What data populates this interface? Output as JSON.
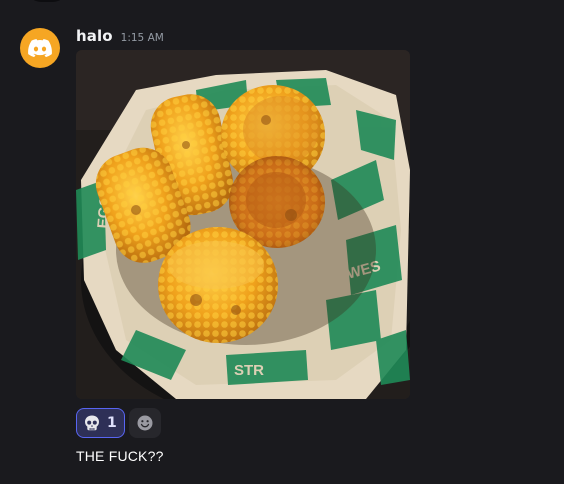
{
  "message": {
    "username": "halo",
    "timestamp": "1:15 AM",
    "avatar_icon": "discord-logo-icon",
    "avatar_color": "#f6a623",
    "attachment": {
      "description_icon": "grilled-corn-photo"
    },
    "reactions": [
      {
        "emoji_icon": "skull-icon",
        "count": "1",
        "active": true
      }
    ],
    "add_reaction_icon": "smiley-icon",
    "text": "THE FUCK??"
  },
  "colors": {
    "background": "#1a1a1e",
    "username": "#f2f3f5",
    "timestamp": "#949ba4",
    "reaction_active_bg": "#2e3057",
    "reaction_active_border": "#5865f2"
  }
}
